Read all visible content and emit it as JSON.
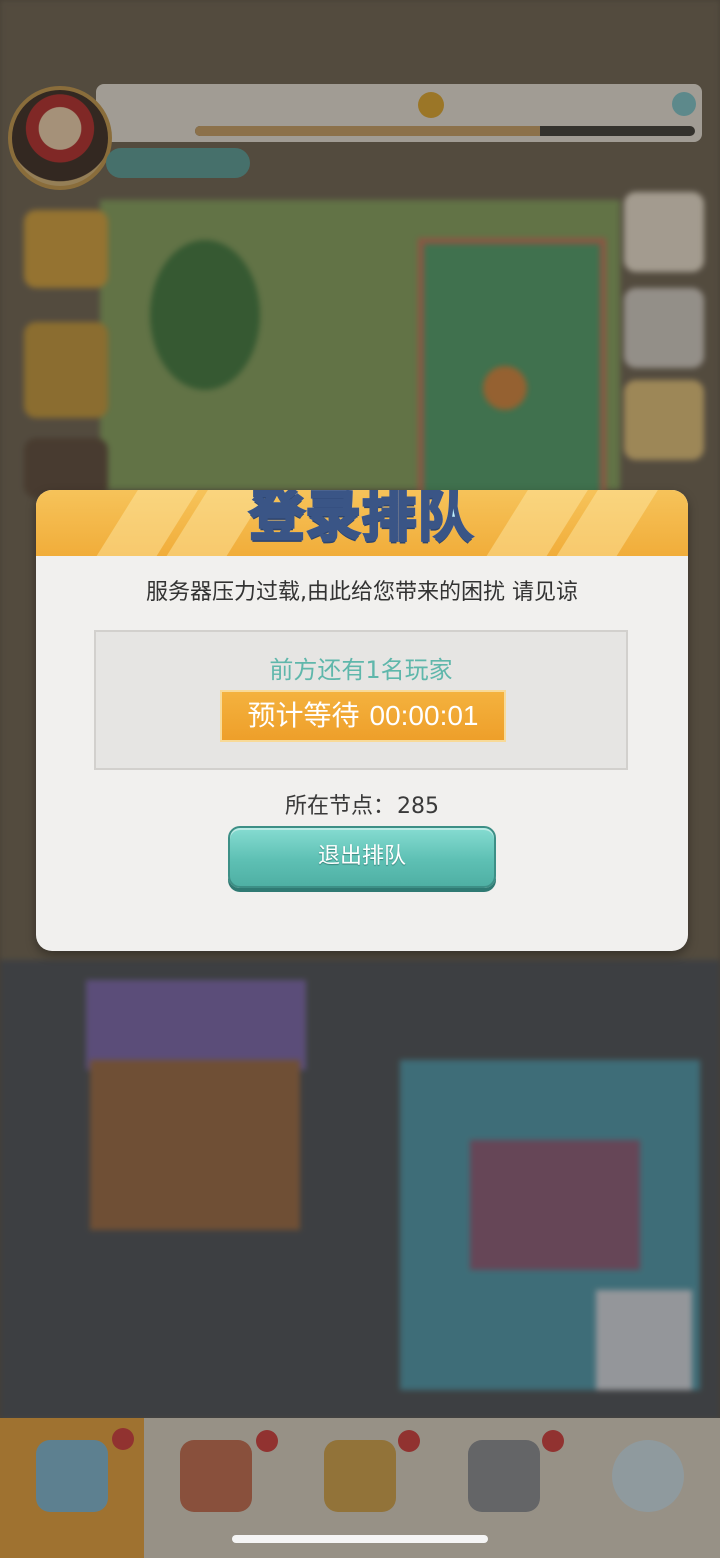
{
  "modal": {
    "title": "登录排队",
    "message": "服务器压力过载,由此给您带来的困扰 请见谅",
    "queue_ahead": "前方还有1名玩家",
    "wait_label": "预计等待",
    "wait_time": "00:00:01",
    "node_label": "所在节点：",
    "node_value": "285",
    "exit_button": "退出排队"
  },
  "background": {
    "avatar_icon": "player-avatar",
    "coin_icon": "gold-coin-icon",
    "gem_icon": "gem-icon",
    "nav_icons": [
      "home-tab-icon",
      "character-tab-icon",
      "shop-tab-icon",
      "cards-tab-icon",
      "chat-tab-icon"
    ],
    "level_progress": 0.69
  },
  "colors": {
    "header_orange": "#f1ad3a",
    "wait_orange": "#ee9f2a",
    "queue_text_teal": "#5fb7ab",
    "button_teal": "#5ec0b4",
    "modal_bg": "#f1f0ee"
  }
}
